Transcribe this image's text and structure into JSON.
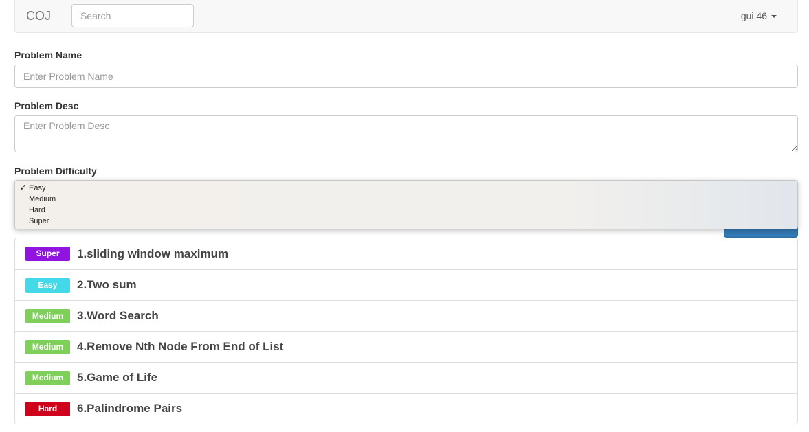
{
  "navbar": {
    "brand": "COJ",
    "search_placeholder": "Search",
    "user": "gui.46"
  },
  "form": {
    "name_label": "Problem Name",
    "name_placeholder": "Enter Problem Name",
    "desc_label": "Problem Desc",
    "desc_placeholder": "Enter Problem Desc",
    "difficulty_label": "Problem Difficulty",
    "difficulty_options": [
      "Easy",
      "Medium",
      "Hard",
      "Super"
    ],
    "difficulty_selected": "Easy"
  },
  "colors": {
    "Super": "#9013e0",
    "Easy": "#44d9e8",
    "Medium": "#7ed05a",
    "Hard": "#d0021b",
    "submit": "#337ab7"
  },
  "problems": [
    {
      "difficulty": "Super",
      "title": "1.sliding window maximum"
    },
    {
      "difficulty": "Easy",
      "title": "2.Two sum"
    },
    {
      "difficulty": "Medium",
      "title": "3.Word Search"
    },
    {
      "difficulty": "Medium",
      "title": "4.Remove Nth Node From End of List"
    },
    {
      "difficulty": "Medium",
      "title": "5.Game of Life"
    },
    {
      "difficulty": "Hard",
      "title": "6.Palindrome Pairs"
    }
  ]
}
